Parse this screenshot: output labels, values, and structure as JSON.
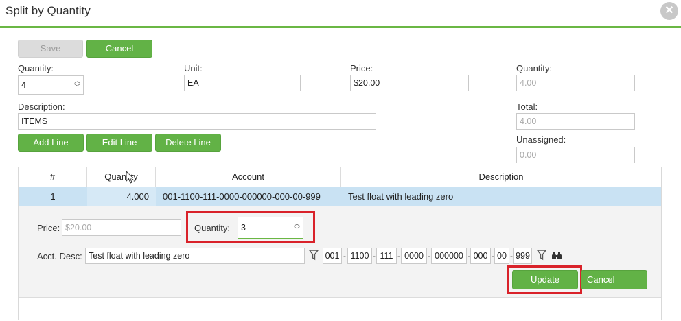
{
  "window": {
    "title": "Split by Quantity"
  },
  "toolbar": {
    "save_label": "Save",
    "cancel_label": "Cancel"
  },
  "form": {
    "quantity_label": "Quantity:",
    "quantity_value": "4",
    "unit_label": "Unit:",
    "unit_value": "EA",
    "price_label": "Price:",
    "price_value": "$20.00",
    "description_label": "Description:",
    "description_value": "ITEMS"
  },
  "summary": {
    "quantity_label": "Quantity:",
    "quantity_value": "4.00",
    "total_label": "Total:",
    "total_value": "4.00",
    "unassigned_label": "Unassigned:",
    "unassigned_value": "0.00"
  },
  "line_buttons": {
    "add": "Add Line",
    "edit": "Edit Line",
    "delete": "Delete Line"
  },
  "grid": {
    "columns": [
      "#",
      "Quantity",
      "Account",
      "Description"
    ],
    "rows": [
      {
        "num": "1",
        "quantity": "4.000",
        "account": "001-1100-111-0000-000000-000-00-999",
        "description": "Test float with leading zero"
      }
    ]
  },
  "editor": {
    "price_label": "Price:",
    "price_placeholder": "$20.00",
    "quantity_label": "Quantity:",
    "quantity_value": "3",
    "acct_desc_label": "Acct. Desc:",
    "acct_desc_value": "Test float with leading zero",
    "account_segments": [
      "001",
      "1100",
      "111",
      "0000",
      "000000",
      "000",
      "00",
      "999"
    ],
    "update_label": "Update",
    "cancel_label": "Cancel"
  },
  "colors": {
    "accent": "#62b246",
    "highlight": "#d9222a",
    "selected_row": "#c9e2f3"
  },
  "icons": [
    "close-icon",
    "filter-icon",
    "binoculars-icon"
  ]
}
